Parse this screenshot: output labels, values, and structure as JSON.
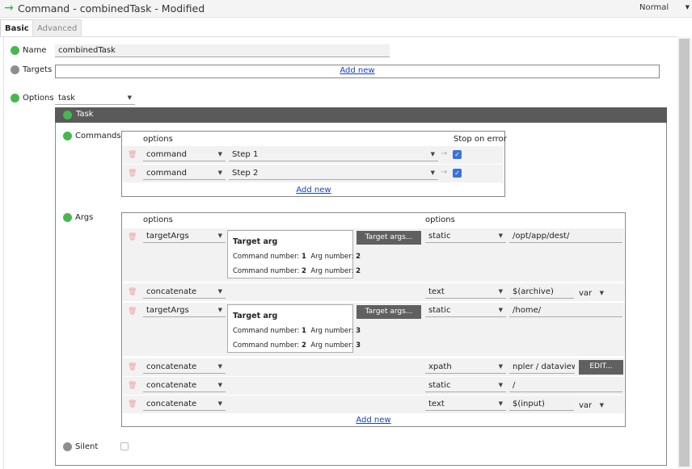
{
  "window": {
    "title": "Command - combinedTask - Modified",
    "mode": "Normal"
  },
  "tabs": [
    "Basic",
    "Advanced"
  ],
  "fields": {
    "name_label": "Name",
    "name_value": "combinedTask",
    "targets_label": "Targets",
    "targets_add": "Add new",
    "options_label": "Options",
    "options_value": "task",
    "silent_label": "Silent"
  },
  "task": {
    "header": "Task",
    "commands_label": "Commands",
    "commands_col_options": "options",
    "commands_col_stop": "Stop on error",
    "commands": [
      {
        "type": "command",
        "value": "Step 1",
        "stop_on_error": true
      },
      {
        "type": "command",
        "value": "Step 2",
        "stop_on_error": true
      }
    ],
    "commands_add": "Add new",
    "args_label": "Args",
    "args_col_options1": "options",
    "args_col_options2": "options",
    "args": [
      {
        "type": "targetArgs",
        "target_box": {
          "title": "Target arg",
          "line1_cmd_label": "Command number:",
          "line1_cmd": "1",
          "line1_arg_label": "Arg number:",
          "line1_arg": "2",
          "line2_cmd_label": "Command number:",
          "line2_cmd": "2",
          "line2_arg_label": "Arg number:",
          "line2_arg": "2"
        },
        "button": "Target args...",
        "source": "static",
        "value": "/opt/app/dest/"
      },
      {
        "type": "concatenate",
        "source": "text",
        "value": "$(archive)",
        "var": "var"
      },
      {
        "type": "targetArgs",
        "target_box": {
          "title": "Target arg",
          "line1_cmd_label": "Command number:",
          "line1_cmd": "1",
          "line1_arg_label": "Arg number:",
          "line1_arg": "3",
          "line2_cmd_label": "Command number:",
          "line2_cmd": "2",
          "line2_arg_label": "Arg number:",
          "line2_arg": "3"
        },
        "button": "Target args...",
        "source": "static",
        "value": "/home/"
      },
      {
        "type": "concatenate",
        "source": "xpath",
        "value": "npler / dataview",
        "button": "EDIT..."
      },
      {
        "type": "concatenate",
        "source": "static",
        "value": "/"
      },
      {
        "type": "concatenate",
        "source": "text",
        "value": "$(input)",
        "var": "var"
      }
    ],
    "args_add": "Add new"
  }
}
